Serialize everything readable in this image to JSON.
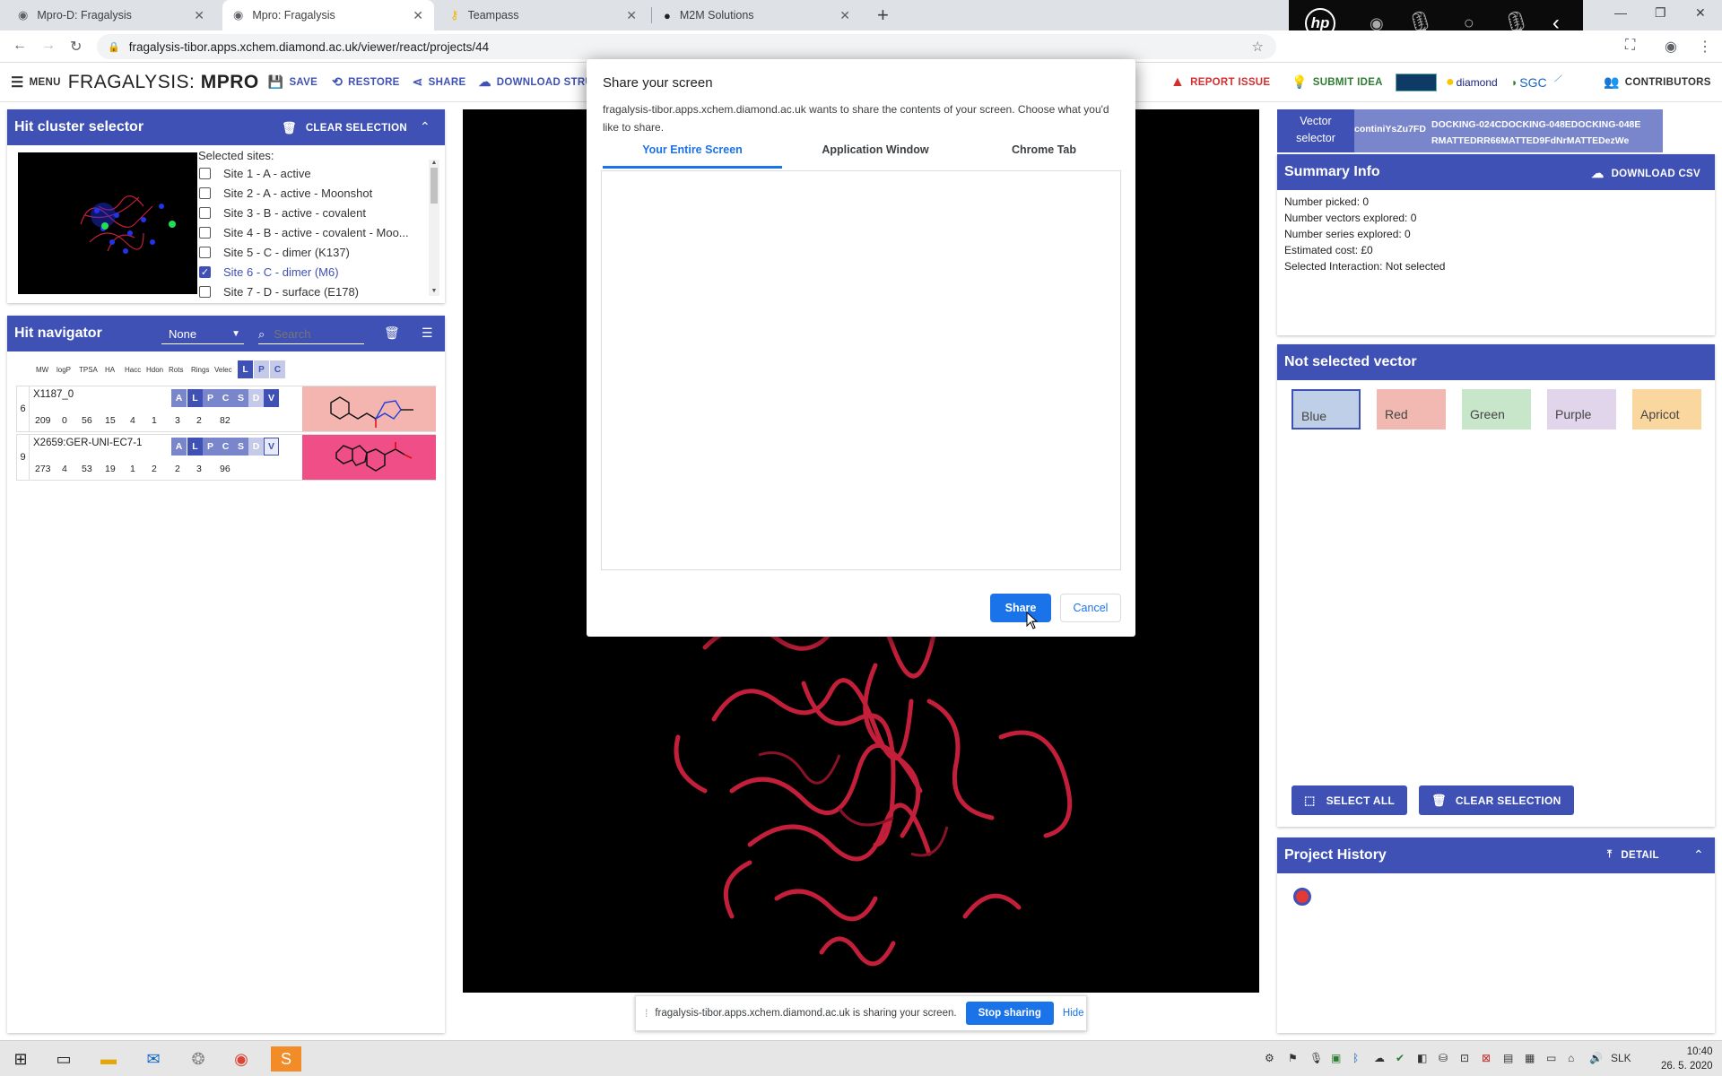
{
  "browser": {
    "tabs": [
      {
        "title": "Mpro-D: Fragalysis",
        "active": false
      },
      {
        "title": "Mpro: Fragalysis",
        "active": true
      },
      {
        "title": "Teampass",
        "active": false
      },
      {
        "title": "M2M Solutions",
        "active": false
      }
    ],
    "url": "fragalysis-tibor.apps.xchem.diamond.ac.uk/viewer/react/projects/44",
    "hp_logo": "hp"
  },
  "header": {
    "menu_label": "MENU",
    "brand": "FRAGALYSIS:",
    "brand_target": "MPRO",
    "save_label": "SAVE",
    "restore_label": "RESTORE",
    "share_label": "SHARE",
    "download_label": "DOWNLOAD STRUCTUR",
    "report_label": "REPORT ISSUE",
    "idea_label": "SUBMIT IDEA",
    "logo_diamond": "diamond",
    "logo_sgc": "SGC",
    "contributors_label": "CONTRIBUTORS"
  },
  "hit_cluster": {
    "title": "Hit cluster selector",
    "clear_label": "CLEAR SELECTION",
    "selected_sites_label": "Selected sites:",
    "sites": [
      {
        "label": "Site 1 - A - active",
        "checked": false
      },
      {
        "label": "Site 2 - A - active - Moonshot",
        "checked": false
      },
      {
        "label": "Site 3 - B - active - covalent",
        "checked": false
      },
      {
        "label": "Site 4 - B - active - covalent - Moo...",
        "checked": false
      },
      {
        "label": "Site 5 - C - dimer (K137)",
        "checked": false
      },
      {
        "label": "Site 6 - C - dimer (M6)",
        "checked": true
      },
      {
        "label": "Site 7 - D - surface (E178)",
        "checked": false
      }
    ]
  },
  "hit_navigator": {
    "title": "Hit navigator",
    "select_value": "None",
    "search_placeholder": "Search",
    "columns": [
      "MW",
      "logP",
      "TPSA",
      "HA",
      "Hacc",
      "Hdon",
      "Rots",
      "Rings",
      "Velec"
    ],
    "lpc": [
      "L",
      "P",
      "C"
    ],
    "flags": [
      "A",
      "L",
      "P",
      "C",
      "S",
      "D",
      "V"
    ],
    "rows": [
      {
        "index": "6",
        "name": "X1187_0",
        "values": [
          "209",
          "0",
          "56",
          "15",
          "4",
          "1",
          "3",
          "2",
          "82"
        ],
        "thumb_color": "#f4b5b0"
      },
      {
        "index": "9",
        "name": "X2659:GER-UNI-EC7-1",
        "values": [
          "273",
          "4",
          "53",
          "19",
          "1",
          "2",
          "2",
          "3",
          "96"
        ],
        "thumb_color": "#ef4f86"
      }
    ]
  },
  "share_dialog": {
    "title": "Share your screen",
    "description": "fragalysis-tibor.apps.xchem.diamond.ac.uk wants to share the contents of your screen. Choose what you'd like to share.",
    "tabs": [
      "Your Entire Screen",
      "Application Window",
      "Chrome Tab"
    ],
    "share_label": "Share",
    "cancel_label": "Cancel"
  },
  "vector_selector": {
    "label_line1": "Vector",
    "label_line2": "selector",
    "tag1": "continiYsZu7FD",
    "tag2_line1": "DOCKING-024CDOCKING-048EDOCKING-048E",
    "tag2_line2": "RMATTEDRR66MATTED9FdNrMATTEDezWe"
  },
  "summary": {
    "title": "Summary Info",
    "download_label": "DOWNLOAD CSV",
    "lines": [
      "Number picked: 0",
      "Number vectors explored: 0",
      "Number series explored: 0",
      "Estimated cost: £0",
      "Selected Interaction: Not selected"
    ]
  },
  "not_selected": {
    "title": "Not selected vector",
    "swatches": [
      {
        "label": "Blue",
        "color": "#bfcfe7"
      },
      {
        "label": "Red",
        "color": "#f2b8b2"
      },
      {
        "label": "Green",
        "color": "#c8e6c9"
      },
      {
        "label": "Purple",
        "color": "#e1d5ec"
      },
      {
        "label": "Apricot",
        "color": "#fbd7a0"
      }
    ],
    "select_all_label": "SELECT ALL",
    "clear_label": "CLEAR SELECTION"
  },
  "project_history": {
    "title": "Project History",
    "detail_label": "DETAIL"
  },
  "share_bar": {
    "text": "fragalysis-tibor.apps.xchem.diamond.ac.uk is sharing your screen.",
    "stop_label": "Stop sharing",
    "hide_label": "Hide"
  },
  "taskbar": {
    "lang": "SLK",
    "time": "10:40",
    "date": "26. 5. 2020"
  },
  "colors": {
    "primary": "#3f51b5",
    "chrome_blue": "#1a73e8",
    "report_red": "#d32f2f",
    "idea_green": "#2e7d32",
    "protein_red": "#c41f3a"
  }
}
